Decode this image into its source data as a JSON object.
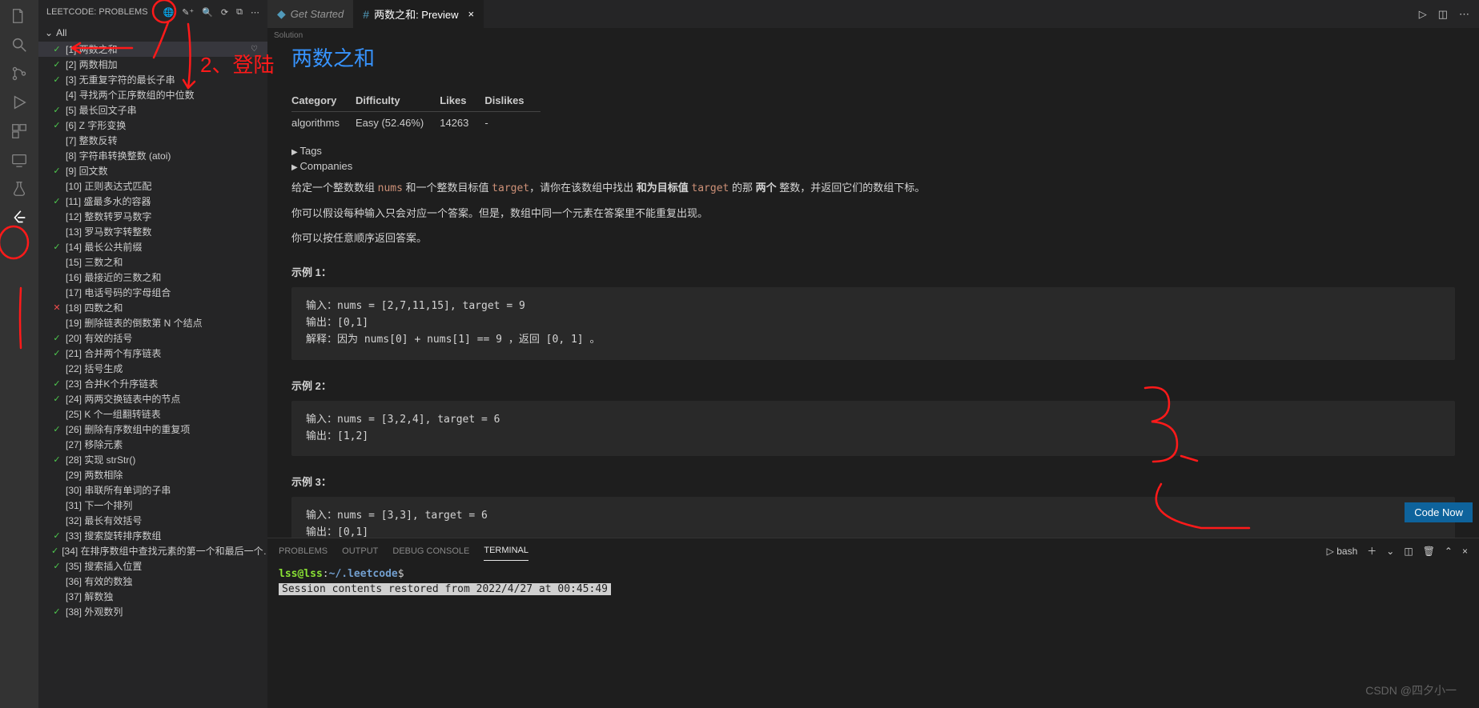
{
  "sidebar": {
    "title": "LEETCODE: PROBLEMS",
    "all_label": "All",
    "problems": [
      {
        "n": 1,
        "title": "[1] 两数之和",
        "status": "ok",
        "fav": true
      },
      {
        "n": 2,
        "title": "[2] 两数相加",
        "status": "ok"
      },
      {
        "n": 3,
        "title": "[3] 无重复字符的最长子串",
        "status": "ok"
      },
      {
        "n": 4,
        "title": "[4] 寻找两个正序数组的中位数",
        "status": ""
      },
      {
        "n": 5,
        "title": "[5] 最长回文子串",
        "status": "ok"
      },
      {
        "n": 6,
        "title": "[6] Z 字形变换",
        "status": "ok"
      },
      {
        "n": 7,
        "title": "[7] 整数反转",
        "status": ""
      },
      {
        "n": 8,
        "title": "[8] 字符串转换整数 (atoi)",
        "status": ""
      },
      {
        "n": 9,
        "title": "[9] 回文数",
        "status": "ok"
      },
      {
        "n": 10,
        "title": "[10] 正则表达式匹配",
        "status": ""
      },
      {
        "n": 11,
        "title": "[11] 盛最多水的容器",
        "status": "ok"
      },
      {
        "n": 12,
        "title": "[12] 整数转罗马数字",
        "status": ""
      },
      {
        "n": 13,
        "title": "[13] 罗马数字转整数",
        "status": ""
      },
      {
        "n": 14,
        "title": "[14] 最长公共前缀",
        "status": "ok"
      },
      {
        "n": 15,
        "title": "[15] 三数之和",
        "status": ""
      },
      {
        "n": 16,
        "title": "[16] 最接近的三数之和",
        "status": ""
      },
      {
        "n": 17,
        "title": "[17] 电话号码的字母组合",
        "status": ""
      },
      {
        "n": 18,
        "title": "[18] 四数之和",
        "status": "fail"
      },
      {
        "n": 19,
        "title": "[19] 删除链表的倒数第 N 个结点",
        "status": ""
      },
      {
        "n": 20,
        "title": "[20] 有效的括号",
        "status": "ok"
      },
      {
        "n": 21,
        "title": "[21] 合并两个有序链表",
        "status": "ok"
      },
      {
        "n": 22,
        "title": "[22] 括号生成",
        "status": ""
      },
      {
        "n": 23,
        "title": "[23] 合并K个升序链表",
        "status": "ok"
      },
      {
        "n": 24,
        "title": "[24] 两两交换链表中的节点",
        "status": "ok"
      },
      {
        "n": 25,
        "title": "[25] K 个一组翻转链表",
        "status": ""
      },
      {
        "n": 26,
        "title": "[26] 删除有序数组中的重复项",
        "status": "ok"
      },
      {
        "n": 27,
        "title": "[27] 移除元素",
        "status": ""
      },
      {
        "n": 28,
        "title": "[28] 实现 strStr()",
        "status": "ok"
      },
      {
        "n": 29,
        "title": "[29] 两数相除",
        "status": ""
      },
      {
        "n": 30,
        "title": "[30] 串联所有单词的子串",
        "status": ""
      },
      {
        "n": 31,
        "title": "[31] 下一个排列",
        "status": ""
      },
      {
        "n": 32,
        "title": "[32] 最长有效括号",
        "status": ""
      },
      {
        "n": 33,
        "title": "[33] 搜索旋转排序数组",
        "status": "ok"
      },
      {
        "n": 34,
        "title": "[34] 在排序数组中查找元素的第一个和最后一个…",
        "status": "ok"
      },
      {
        "n": 35,
        "title": "[35] 搜索插入位置",
        "status": "ok"
      },
      {
        "n": 36,
        "title": "[36] 有效的数独",
        "status": ""
      },
      {
        "n": 37,
        "title": "[37] 解数独",
        "status": ""
      },
      {
        "n": 38,
        "title": "[38] 外观数列",
        "status": "ok"
      }
    ]
  },
  "tabs": {
    "get_started": "Get Started",
    "preview": "两数之和: Preview"
  },
  "solution_banner": "Solution",
  "problem": {
    "title": "两数之和",
    "headers": {
      "category": "Category",
      "difficulty": "Difficulty",
      "likes": "Likes",
      "dislikes": "Dislikes"
    },
    "category": "algorithms",
    "difficulty": "Easy (52.46%)",
    "likes": "14263",
    "dislikes": "-",
    "tags_label": "Tags",
    "companies_label": "Companies",
    "desc_line1_pre": "给定一个整数数组 ",
    "desc_line1_code1": "nums",
    "desc_line1_mid": " 和一个整数目标值 ",
    "desc_line1_code2": "target",
    "desc_line1_mid2": "，请你在该数组中找出 ",
    "desc_line1_bold": "和为目标值",
    "desc_line1_mid3": " ",
    "desc_line1_code3": "target",
    "desc_line1_mid4": " 的那 ",
    "desc_line1_bold2": "两个",
    "desc_line1_end": " 整数，并返回它们的数组下标。",
    "desc_line2": "你可以假设每种输入只会对应一个答案。但是，数组中同一个元素在答案里不能重复出现。",
    "desc_line3": "你可以按任意顺序返回答案。",
    "ex1_title": "示例 1：",
    "ex1": "输入：nums = [2,7,11,15], target = 9\n输出：[0,1]\n解释：因为 nums[0] + nums[1] == 9 ，返回 [0, 1] 。",
    "ex2_title": "示例 2：",
    "ex2": "输入：nums = [3,2,4], target = 6\n输出：[1,2]",
    "ex3_title": "示例 3：",
    "ex3": "输入：nums = [3,3], target = 6\n输出：[0,1]",
    "code_now": "Code Now"
  },
  "panel": {
    "tabs": {
      "problems": "PROBLEMS",
      "output": "OUTPUT",
      "debug": "DEBUG CONSOLE",
      "terminal": "TERMINAL"
    },
    "shell": "bash",
    "prompt_user": "lss@lss",
    "prompt_sep": ":",
    "prompt_path": "~/.leetcode",
    "prompt_end": "$",
    "session": " Session contents restored from 2022/4/27 at 00:45:49 "
  },
  "watermark": "CSDN @四夕小一",
  "annotations": {
    "login": "2、登陆"
  }
}
